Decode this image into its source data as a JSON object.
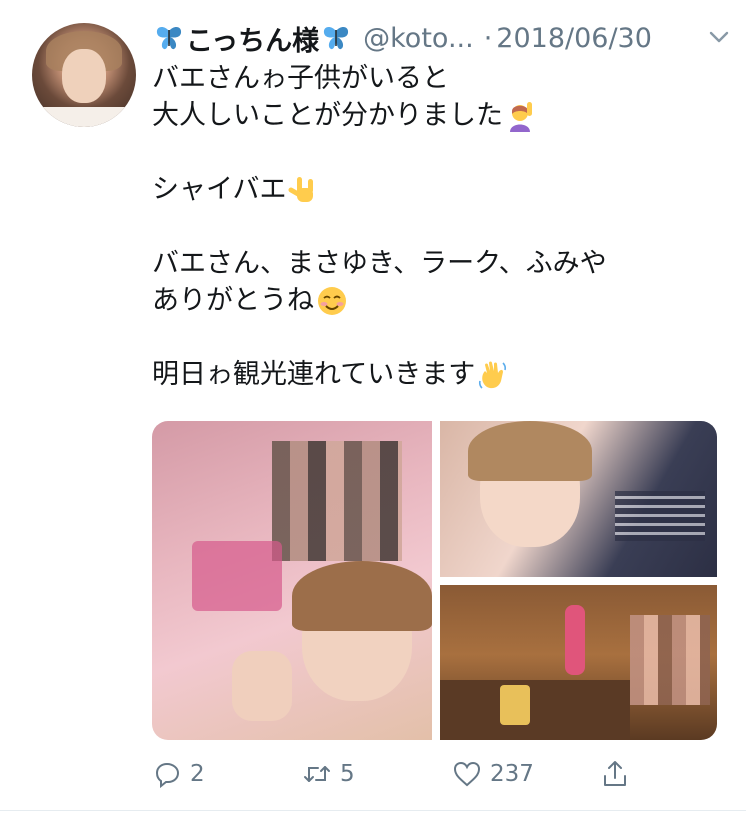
{
  "tweet": {
    "display_name": "こっちん様",
    "handle": "@koto...",
    "separator": "·",
    "date": "2018/06/30",
    "lines": [
      "バエさんゎ子供がいると",
      "大人しいことが分かりました",
      "",
      "シャイバエ",
      "",
      "バエさん、まさゆき、ラーク、ふみや",
      "ありがとうね",
      "",
      "明日ゎ観光連れていきます"
    ],
    "emojis": {
      "name_left": "butterfly-icon",
      "name_right": "butterfly-icon",
      "line2": "raising-hand-icon",
      "line4": "rock-on-hand-icon",
      "line7": "smiling-face-icon",
      "line9": "waving-hand-icon"
    }
  },
  "media": {
    "images": [
      "selfie-photo",
      "selfie-photo-2",
      "restaurant-photo"
    ]
  },
  "actions": {
    "reply_count": "2",
    "retweet_count": "5",
    "like_count": "237",
    "share_icon": "share-icon"
  },
  "colors": {
    "text": "#14171a",
    "muted": "#657786",
    "divider": "#e6ecf0"
  }
}
